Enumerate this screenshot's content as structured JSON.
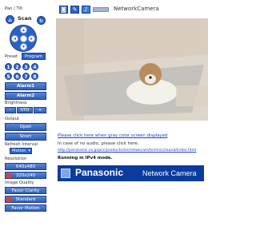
{
  "header": {
    "camera_name": "NetworkCamera",
    "icons": [
      "camera-icon",
      "tools-icon",
      "audio-icon",
      "display-icon"
    ]
  },
  "left_panel": {
    "pan_tilt_label": "Pan / Tilt",
    "scan_label": "Scan",
    "preset_label": "Preset",
    "program_label": "Program",
    "preset_numbers": [
      "1",
      "2",
      "3",
      "4",
      "5",
      "6",
      "7",
      "8"
    ],
    "alarm1_label": "Alarm1",
    "alarm2_label": "Alarm2",
    "brightness_label": "Brightness",
    "brightness_minus": "-",
    "brightness_std": "STD",
    "brightness_plus": "+",
    "output_label": "Output",
    "open_label": "Open",
    "short_label": "Short",
    "refresh_label": "Refresh Interval",
    "refresh_value": "Motion",
    "resolution_label": "Resolution",
    "res_640": "640x480",
    "res_320": "320x240",
    "quality_label": "Image Quality",
    "q_favor_clarity": "Favor Clarity",
    "q_standard": "Standard",
    "q_favor_motion": "Favor Motion"
  },
  "main": {
    "link_gray": "Please click here when gray color screen displayed",
    "no_audio_text": "In case of no audio, please click here.",
    "sound_url": "http://panasonic.co.jp/pcc/products/en/netwkcam/technic/sound/index.html",
    "ipv4_text": "Running in IPv4 mode.",
    "banner_brand": "Panasonic",
    "banner_product": "Network Camera"
  }
}
